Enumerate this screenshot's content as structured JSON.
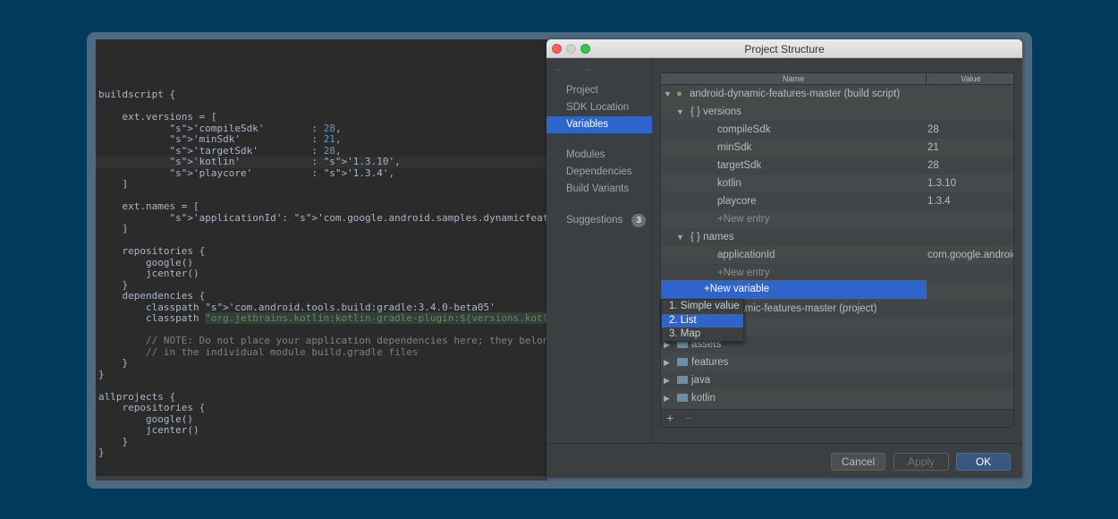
{
  "code_lines": [
    "buildscript {",
    "",
    "    ext.versions = [",
    "            'compileSdk'        : 28,",
    "            'minSdk'            : 21,",
    "            'targetSdk'         : 28,",
    "            'kotlin'            : '1.3.10',",
    "            'playcore'          : '1.3.4',",
    "    ]",
    "",
    "    ext.names = [",
    "            'applicationId': 'com.google.android.samples.dynamicfeatures.ondemand'",
    "    ]",
    "",
    "    repositories {",
    "        google()",
    "        jcenter()",
    "    }",
    "    dependencies {",
    "        classpath 'com.android.tools.build:gradle:3.4.0-beta05'",
    "        classpath \"org.jetbrains.kotlin:kotlin-gradle-plugin:${versions.kotlin}\"",
    "",
    "        // NOTE: Do not place your application dependencies here; they belong",
    "        // in the individual module build.gradle files",
    "    }",
    "}",
    "",
    "allprojects {",
    "    repositories {",
    "        google()",
    "        jcenter()",
    "    }",
    "}"
  ],
  "dialog": {
    "title": "Project Structure",
    "nav_arrows": "← →",
    "sidebar": {
      "items": [
        "Project",
        "SDK Location",
        "Variables",
        "Modules",
        "Dependencies",
        "Build Variants",
        "Suggestions"
      ],
      "selected": "Variables",
      "suggestions_count": "3"
    },
    "table": {
      "col_name": "Name",
      "col_value": "Value",
      "build_script": "android-dynamic-features-master (build script)",
      "versions_label": "{ } versions",
      "versions": [
        {
          "name": "compileSdk",
          "value": "28"
        },
        {
          "name": "minSdk",
          "value": "21"
        },
        {
          "name": "targetSdk",
          "value": "28"
        },
        {
          "name": "kotlin",
          "value": "1.3.10"
        },
        {
          "name": "playcore",
          "value": "1.3.4"
        }
      ],
      "new_entry": "+New entry",
      "names_label": "{ } names",
      "names": [
        {
          "name": "applicationId",
          "value": "com.google.android"
        }
      ],
      "new_variable": "+New variable",
      "project_row": "namic-features-master (project)",
      "modules": [
        "assets",
        "features",
        "java",
        "kotlin"
      ],
      "add": "+",
      "remove": "−"
    },
    "popup": {
      "options": [
        "1. Simple value",
        "2. List",
        "3. Map"
      ],
      "selected": "2. List"
    },
    "buttons": {
      "cancel": "Cancel",
      "apply": "Apply",
      "ok": "OK"
    }
  },
  "colors": {
    "background": "#003a5c",
    "selection": "#2f65ca",
    "string": "#6a8759",
    "number": "#6897bb"
  }
}
